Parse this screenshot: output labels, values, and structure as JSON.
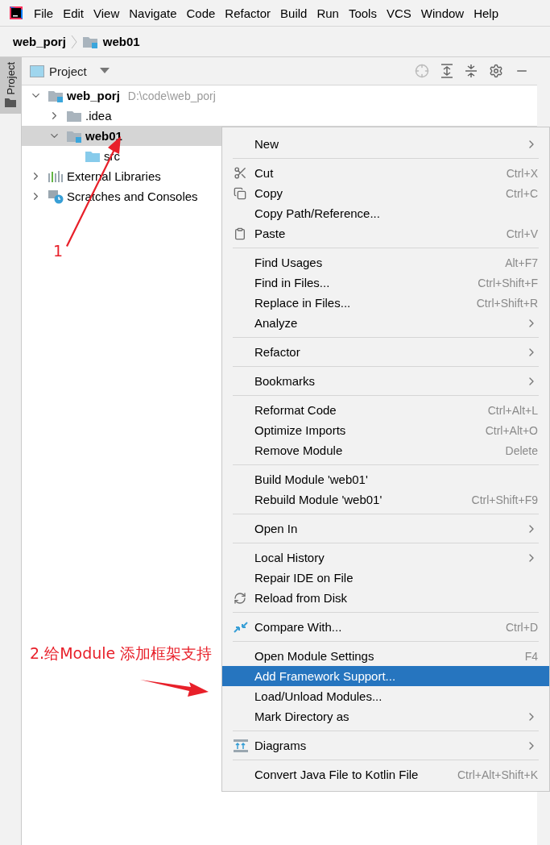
{
  "menu_bar": [
    "File",
    "Edit",
    "View",
    "Navigate",
    "Code",
    "Refactor",
    "Build",
    "Run",
    "Tools",
    "VCS",
    "Window",
    "Help"
  ],
  "breadcrumb": [
    {
      "label": "web_porj",
      "kind": "project"
    },
    {
      "label": "web01",
      "kind": "module"
    }
  ],
  "side_tab": {
    "label": "Project",
    "selected": true
  },
  "panel": {
    "title": "Project"
  },
  "tree": [
    {
      "label": "web_porj",
      "path": "D:\\code\\web_porj",
      "kind": "module",
      "bold": true,
      "selected": false,
      "expanded": true,
      "children": [
        {
          "label": ".idea",
          "kind": "folder",
          "bold": false,
          "selected": false,
          "expanded": false
        },
        {
          "label": "web01",
          "kind": "module",
          "bold": true,
          "selected": true,
          "expanded": true,
          "children": [
            {
              "label": "src",
              "kind": "source",
              "bold": false,
              "selected": false
            }
          ]
        }
      ]
    },
    {
      "label": "External Libraries",
      "kind": "libraries",
      "bold": false,
      "selected": false,
      "expanded": false
    },
    {
      "label": "Scratches and Consoles",
      "kind": "scratches",
      "bold": false,
      "selected": false,
      "expanded": false
    }
  ],
  "context_menu": [
    [
      {
        "label": "New",
        "submenu": true,
        "selected": false
      }
    ],
    [
      {
        "label": "Cut",
        "shortcut": "Ctrl+X",
        "kind": "cut",
        "selected": false
      },
      {
        "label": "Copy",
        "shortcut": "Ctrl+C",
        "kind": "copy",
        "selected": false
      },
      {
        "label": "Copy Path/Reference...",
        "selected": false
      },
      {
        "label": "Paste",
        "shortcut": "Ctrl+V",
        "kind": "paste",
        "selected": false
      }
    ],
    [
      {
        "label": "Find Usages",
        "shortcut": "Alt+F7",
        "selected": false
      },
      {
        "label": "Find in Files...",
        "shortcut": "Ctrl+Shift+F",
        "selected": false
      },
      {
        "label": "Replace in Files...",
        "shortcut": "Ctrl+Shift+R",
        "selected": false
      },
      {
        "label": "Analyze",
        "submenu": true,
        "selected": false
      }
    ],
    [
      {
        "label": "Refactor",
        "submenu": true,
        "selected": false
      }
    ],
    [
      {
        "label": "Bookmarks",
        "submenu": true,
        "selected": false
      }
    ],
    [
      {
        "label": "Reformat Code",
        "shortcut": "Ctrl+Alt+L",
        "selected": false
      },
      {
        "label": "Optimize Imports",
        "shortcut": "Ctrl+Alt+O",
        "selected": false
      },
      {
        "label": "Remove Module",
        "shortcut": "Delete",
        "selected": false
      }
    ],
    [
      {
        "label": "Build Module 'web01'",
        "selected": false
      },
      {
        "label": "Rebuild Module 'web01'",
        "shortcut": "Ctrl+Shift+F9",
        "selected": false
      }
    ],
    [
      {
        "label": "Open In",
        "submenu": true,
        "selected": false
      }
    ],
    [
      {
        "label": "Local History",
        "submenu": true,
        "selected": false
      },
      {
        "label": "Repair IDE on File",
        "selected": false
      },
      {
        "label": "Reload from Disk",
        "kind": "reload",
        "selected": false
      }
    ],
    [
      {
        "label": "Compare With...",
        "shortcut": "Ctrl+D",
        "kind": "compare",
        "selected": false
      }
    ],
    [
      {
        "label": "Open Module Settings",
        "shortcut": "F4",
        "selected": false
      },
      {
        "label": "Add Framework Support...",
        "selected": true
      },
      {
        "label": "Load/Unload Modules...",
        "selected": false
      },
      {
        "label": "Mark Directory as",
        "submenu": true,
        "selected": false
      }
    ],
    [
      {
        "label": "Diagrams",
        "submenu": true,
        "kind": "diagrams",
        "selected": false
      }
    ],
    [
      {
        "label": "Convert Java File to Kotlin File",
        "shortcut": "Ctrl+Alt+Shift+K",
        "selected": false
      }
    ]
  ],
  "annotations": [
    {
      "label": "1"
    },
    {
      "label": "2.给Module 添加框架支持"
    }
  ]
}
